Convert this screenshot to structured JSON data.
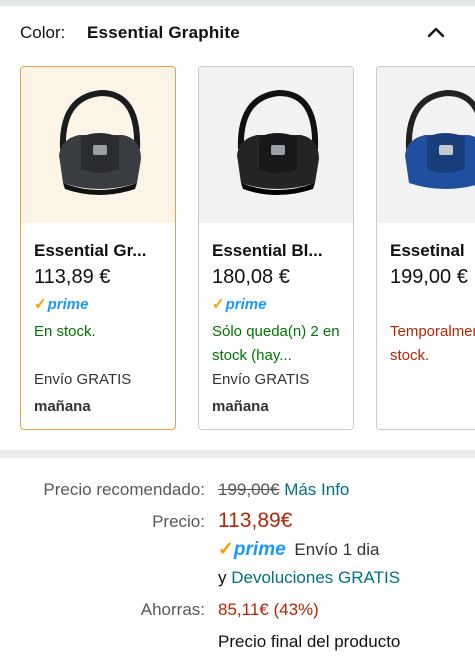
{
  "color_selector": {
    "label": "Color:",
    "selected_value": "Essential Graphite"
  },
  "variants": [
    {
      "name": "Essential Gr...",
      "price": "113,89 €",
      "prime": "prime",
      "stock": "En stock.",
      "shipping": "Envío GRATIS",
      "delivery": "mañana",
      "image_color": "#3a3d41",
      "selected": true
    },
    {
      "name": "Essential Bl...",
      "price": "180,08 €",
      "prime": "prime",
      "stock": "Sólo queda(n) 2 en stock (hay...",
      "shipping": "Envío GRATIS",
      "delivery": "mañana",
      "image_color": "#222426",
      "selected": false
    },
    {
      "name": "Essetinal",
      "price": "199,00 €",
      "stock": "Temporalmente sin stock.",
      "image_color": "#1f4f9e",
      "selected": false
    }
  ],
  "pricing": {
    "rrp_label": "Precio recomendado:",
    "rrp_value": "199,00€",
    "more_info": "Más Info",
    "price_label": "Precio:",
    "price_value": "113,89€",
    "prime": "prime",
    "delivery": "Envío 1 dia",
    "and_text": "y",
    "returns_link": "Devoluciones GRATIS",
    "savings_label": "Ahorras:",
    "savings_value": "85,11€ (43%)",
    "final_price_note": "Precio final del producto"
  },
  "colors": {
    "accent_border": "#e3a04d",
    "in_stock": "#007600",
    "out_of_stock": "#b12704",
    "link": "#007185",
    "prime_blue": "#1a98ff",
    "prime_check": "#ff9900"
  }
}
